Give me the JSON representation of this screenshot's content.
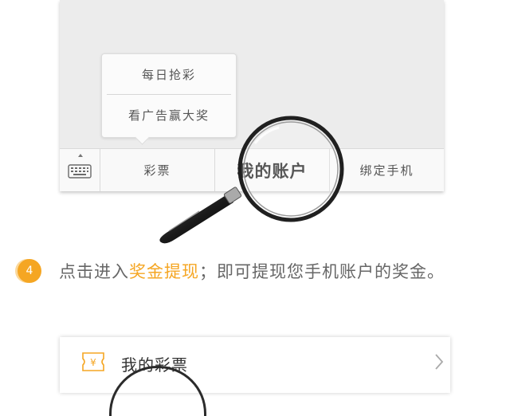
{
  "popup_menu": {
    "items": [
      {
        "label": "每日抢彩"
      },
      {
        "label": "看广告赢大奖"
      }
    ]
  },
  "bottom_bar": {
    "keyboard_icon": "keyboard-icon",
    "items": [
      {
        "label": "彩票"
      },
      {
        "label": "我的账户"
      },
      {
        "label": "绑定手机"
      }
    ]
  },
  "step": {
    "number": "4",
    "text_before": "点击进入",
    "highlight": "奖金提现",
    "text_after": "；即可提现您手机账户的奖金。"
  },
  "account_row": {
    "icon": "lottery-ticket-icon",
    "label": "我的彩票"
  },
  "colors": {
    "accent": "#f5a623",
    "panel_bg": "#ececec",
    "text_primary": "#333333",
    "text_secondary": "#666666"
  }
}
